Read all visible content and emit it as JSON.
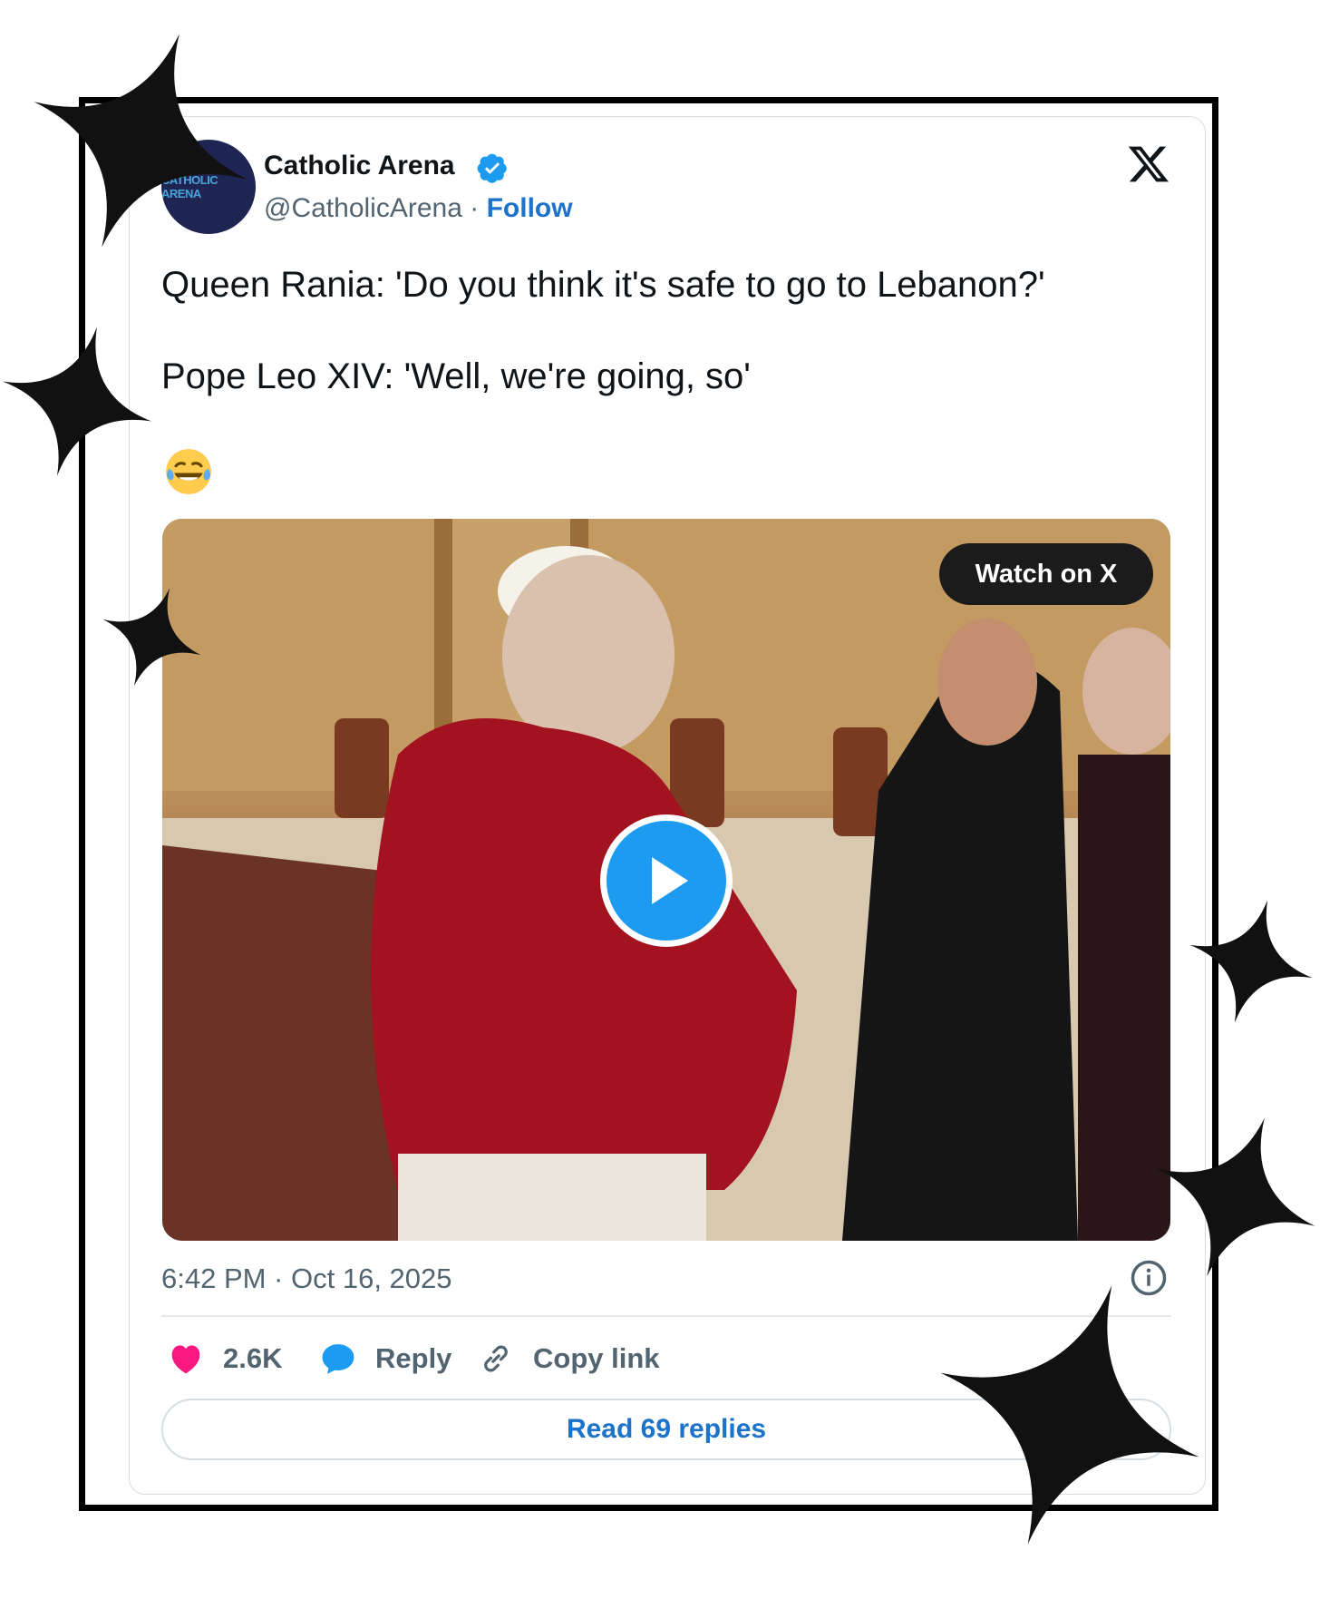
{
  "tweet": {
    "author_name": "Catholic Arena",
    "avatar_text": "CATHOLIC ARENA",
    "handle": "@CatholicArena",
    "separator": "·",
    "follow_label": "Follow",
    "text_line1": "Queen Rania: 'Do you think it's safe to go to Lebanon?'",
    "text_line2": "Pope Leo XIV: 'Well, we're going, so'",
    "emoji_icon": "face-with-tears-of-joy-icon",
    "video": {
      "watch_label": "Watch on X"
    },
    "timestamp": "6:42 PM · Oct 16, 2025",
    "actions": {
      "likes": "2.6K",
      "reply_label": "Reply",
      "copy_link_label": "Copy link"
    },
    "read_replies_label": "Read 69 replies"
  },
  "colors": {
    "link": "#1d72c9",
    "verified": "#1d9bf0",
    "heart": "#f91880",
    "reply_bubble": "#1d9bf0",
    "frame": "#000000"
  }
}
